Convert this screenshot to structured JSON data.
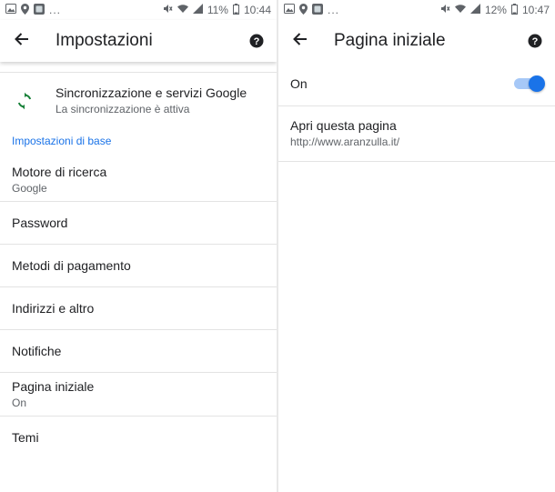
{
  "colors": {
    "accent": "#1a73e8",
    "sync_icon": "#188038"
  },
  "left": {
    "status": {
      "notifications": [
        "image-icon",
        "location-icon",
        "app-icon"
      ],
      "more": "...",
      "battery_text": "11%",
      "time": "10:44"
    },
    "toolbar": {
      "title": "Impostazioni",
      "back_icon": "arrow-back-icon",
      "help_icon": "help-icon"
    },
    "sync": {
      "title": "Sincronizzazione e servizi Google",
      "subtitle": "La sincronizzazione è attiva",
      "icon": "sync-icon"
    },
    "section_header": "Impostazioni di base",
    "items": [
      {
        "label": "Motore di ricerca",
        "value": "Google"
      },
      {
        "label": "Password"
      },
      {
        "label": "Metodi di pagamento"
      },
      {
        "label": "Indirizzi e altro"
      },
      {
        "label": "Notifiche"
      },
      {
        "label": "Pagina iniziale",
        "value": "On"
      },
      {
        "label": "Temi"
      }
    ]
  },
  "right": {
    "status": {
      "notifications": [
        "image-icon",
        "location-icon",
        "app-icon"
      ],
      "more": "...",
      "battery_text": "12%",
      "time": "10:47"
    },
    "toolbar": {
      "title": "Pagina iniziale",
      "back_icon": "arrow-back-icon",
      "help_icon": "help-icon"
    },
    "toggle": {
      "label": "On",
      "checked": true
    },
    "open_page": {
      "title": "Apri questa pagina",
      "url": "http://www.aranzulla.it/"
    }
  }
}
